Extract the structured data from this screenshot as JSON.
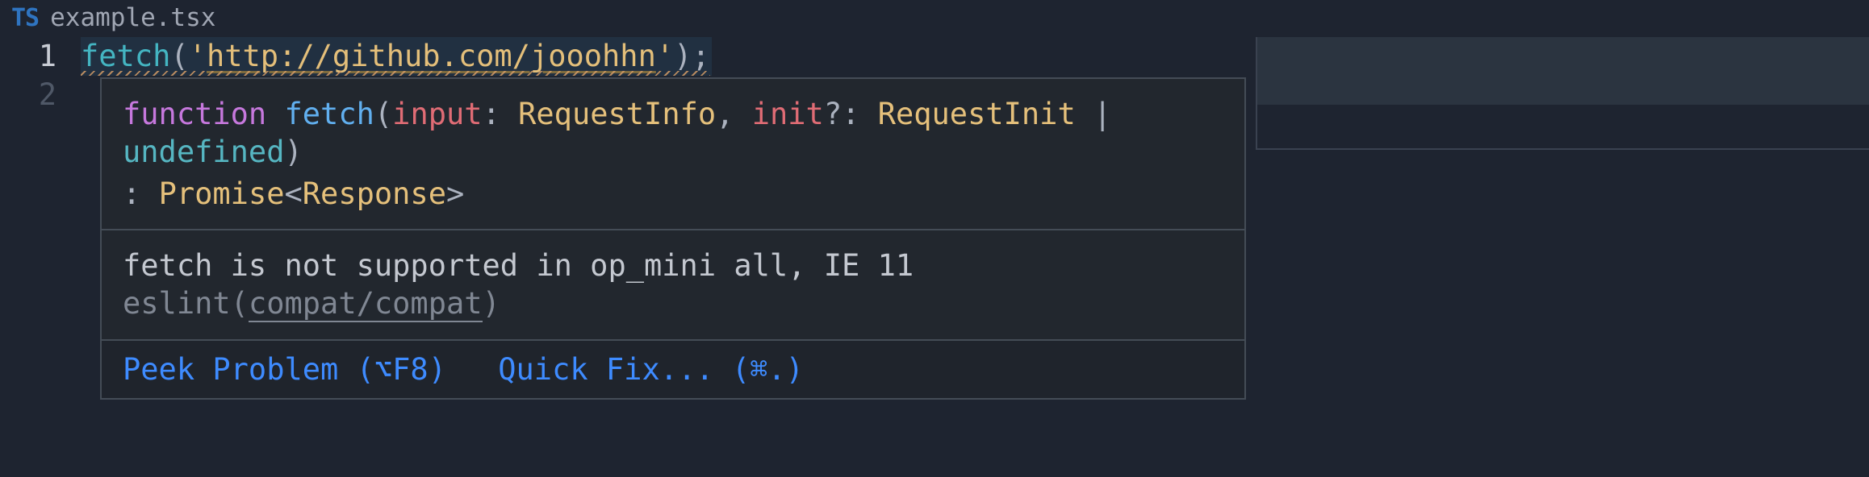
{
  "tab": {
    "icon_text": "TS",
    "filename": "example.tsx"
  },
  "gutter": {
    "line1": "1",
    "line2": "2"
  },
  "code": {
    "fn_name": "fetch",
    "lparen": "(",
    "quote1": "'",
    "url_plain": "http://github.com/jooohhn",
    "quote2": "'",
    "rparen_semi": ");"
  },
  "hover": {
    "sig": {
      "kw_function": "function",
      "fn_name": "fetch",
      "lparen": "(",
      "param1_name": "input",
      "colon1": ":",
      "type1": "RequestInfo",
      "comma": ",",
      "param2_name": "init",
      "opt_q": "?",
      "colon2": ":",
      "type2": "RequestInit",
      "bar": "|",
      "undef": "undefined",
      "rparen": ")",
      "ret_colon": ":",
      "ret_type": "Promise",
      "angle_l": "<",
      "ret_arg": "Response",
      "angle_r": ">"
    },
    "problem": {
      "message": "fetch is not supported in op_mini all, IE 11",
      "source_prefix": "eslint(",
      "rule": "compat/compat",
      "source_suffix": ")"
    },
    "actions": {
      "peek": "Peek Problem (⌥F8)",
      "quickfix": "Quick Fix... (⌘.)"
    }
  }
}
